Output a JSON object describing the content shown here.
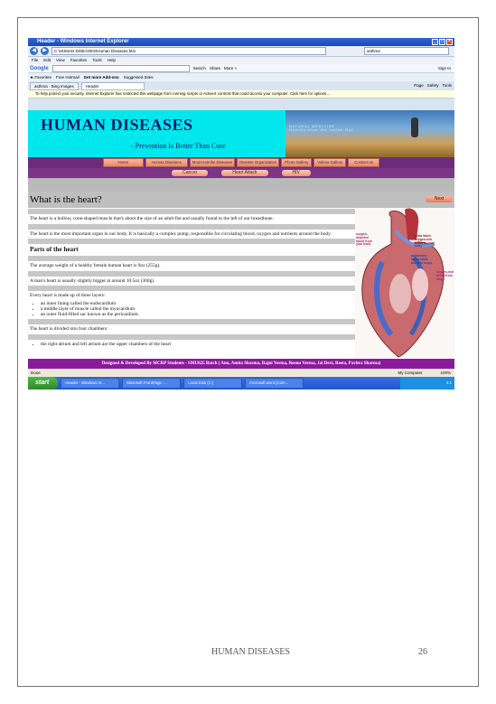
{
  "browser": {
    "window_title": "Header - Windows Internet Explorer",
    "address": "C:\\HUMAN DISEASES\\Human Diseases.htm",
    "search_text": "asthma",
    "menu": [
      "File",
      "Edit",
      "View",
      "Favorites",
      "Tools",
      "Help"
    ],
    "google_label": "Google",
    "google_items": [
      "Search",
      "Share",
      "More »"
    ],
    "sign_in": "Sign In",
    "favorites_label": "Favorites",
    "fav_items": [
      "Free Hotmail",
      "Get more Add-ons",
      "Suggested Sites"
    ],
    "tabs": [
      "asthma - Bing Images",
      "Header"
    ],
    "tools_right": [
      "Page",
      "Safety",
      "Tools"
    ],
    "infobar": "To help protect your security, Internet Explorer has restricted this webpage from running scripts or ActiveX controls that could access your computer. Click here for options...",
    "status_left": "Done",
    "status_zone": "My Computer",
    "zoom": "100%"
  },
  "site": {
    "title": "HUMAN DISEASES",
    "tagline": "- Prevention Is Better Than Cure",
    "photo_text": "NATURAL MEDICINE",
    "photo_subtext": "Healthy from the Inside Out",
    "nav": [
      "Home",
      "Human Diseases",
      "Most Harmful Diseases",
      "Disease Organization",
      "Photo Gallery",
      "Videos Gallery",
      "Contact Us"
    ],
    "subnav": [
      "Cancer",
      "Heart Attack",
      "HIV"
    ],
    "next": "Next",
    "footer": "Designed & Developed By MCRP Students - SMU025 Batch ( Anu, Amita Sharma, Rajni Verma, Reenu Verma, Jai Devi, Reeta, Pavitra Sharma)"
  },
  "article": {
    "heading": "What is the heart?",
    "p1": "The heart is a hollow, cone-shaped muscle that's about the size of an adult fist and usually found to the left of our breastbone.",
    "p2": "The heart is the most important organ in our body. It is basically a complex pump, responsible for circulating blood, oxygen and nutrients around the body.",
    "subheading": "Parts of the heart",
    "p3": "The average weight of a healthy female human heart is 9oz (255g).",
    "p4": "A man's heart is usually slightly bigger at around 10.5oz (300g).",
    "p5": "Every heart is made up of three layers:",
    "layers": [
      "an inner lining called the endocardium",
      "a middle layer of muscle called the myocardium",
      "an outer fluid-filled sac known as the pericardium."
    ],
    "p6": "The heart is divided into four chambers:",
    "chambers": [
      "the right atrium and left atrium are the upper chambers of the heart"
    ]
  },
  "heart_labels": {
    "l1": "oxygen-depleted blood from your body",
    "l2": "aorta takes oxygen-rich blood to your body",
    "l3": "pulmonary artery takes blood to lungs",
    "l4": "oxygen-rich blood from lungs"
  },
  "taskbar": {
    "start": "start",
    "tasks": [
      "Header - Windows In...",
      "Microsoft FrontPage -...",
      "Local Disk (C:)",
      "microsoft word [Com..."
    ],
    "clock": "3:1"
  },
  "page": {
    "footer_title": "HUMAN DISEASES",
    "page_number": "26"
  },
  "colors": {
    "banner": "#00e7ee",
    "nav_bar": "#6c2c7a",
    "footer_credit": "#8b1a9a",
    "button": "#e8856d"
  }
}
